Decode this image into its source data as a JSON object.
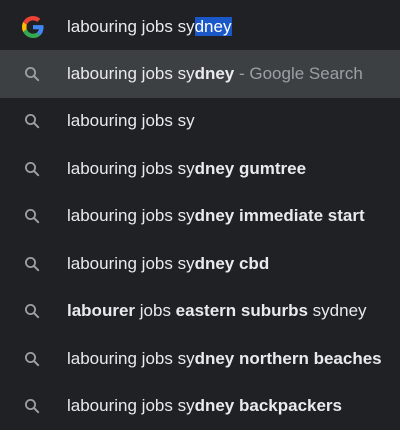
{
  "input": {
    "typed": "labouring jobs sy",
    "autocompleted": "dney"
  },
  "suggestions": [
    {
      "segments": [
        {
          "t": "labouring jobs sy",
          "b": false
        },
        {
          "t": "dney",
          "b": true
        }
      ],
      "hint": " - Google Search",
      "active": true
    },
    {
      "segments": [
        {
          "t": "labouring jobs sy",
          "b": false
        }
      ],
      "hint": "",
      "active": false
    },
    {
      "segments": [
        {
          "t": "labouring jobs sy",
          "b": false
        },
        {
          "t": "dney gumtree",
          "b": true
        }
      ],
      "hint": "",
      "active": false
    },
    {
      "segments": [
        {
          "t": "labouring jobs sy",
          "b": false
        },
        {
          "t": "dney immediate start",
          "b": true
        }
      ],
      "hint": "",
      "active": false
    },
    {
      "segments": [
        {
          "t": "labouring jobs sy",
          "b": false
        },
        {
          "t": "dney cbd",
          "b": true
        }
      ],
      "hint": "",
      "active": false
    },
    {
      "segments": [
        {
          "t": "labourer",
          "b": true
        },
        {
          "t": " jobs ",
          "b": false
        },
        {
          "t": "eastern suburbs",
          "b": true
        },
        {
          "t": " sydney",
          "b": false
        }
      ],
      "hint": "",
      "active": false
    },
    {
      "segments": [
        {
          "t": "labouring jobs sy",
          "b": false
        },
        {
          "t": "dney northern beaches",
          "b": true
        }
      ],
      "hint": "",
      "active": false
    },
    {
      "segments": [
        {
          "t": "labouring jobs sy",
          "b": false
        },
        {
          "t": "dney backpackers",
          "b": true
        }
      ],
      "hint": "",
      "active": false
    }
  ],
  "icons": {
    "input_icon": "google-g-icon",
    "suggestion_icon": "search-icon"
  },
  "colors": {
    "background": "#202124",
    "active_row": "#3c4043",
    "selection": "#1a57c9",
    "hint": "#9aa0a6"
  }
}
